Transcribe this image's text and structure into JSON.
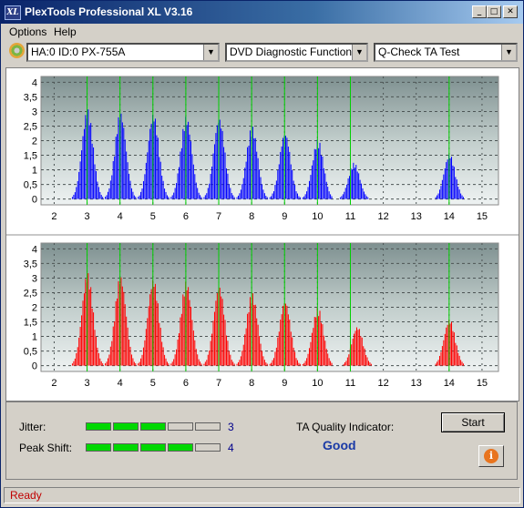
{
  "app": {
    "title": "PlexTools Professional XL V3.16",
    "icon_text": "XL",
    "buttons": {
      "minimize": "_",
      "maximize": "□",
      "close": "✕"
    }
  },
  "menu": [
    "Options",
    "Help"
  ],
  "toolbar": {
    "drive": "HA:0 ID:0  PX-755A",
    "function": "DVD Diagnostic Functions",
    "test": "Q-Check TA Test"
  },
  "chart_data": [
    {
      "type": "bar",
      "name": "top",
      "color": "#0000ff",
      "xlim": [
        1.6,
        15.5
      ],
      "ylim": [
        -0.2,
        4.2
      ],
      "x_ticks": [
        "2",
        "3",
        "4",
        "5",
        "6",
        "7",
        "8",
        "9",
        "10",
        "11",
        "12",
        "13",
        "14",
        "15"
      ],
      "y_ticks": [
        "0",
        "0,5",
        "1",
        "1,5",
        "2",
        "2,5",
        "3",
        "3,5",
        "4"
      ],
      "markers": [
        3,
        4,
        5,
        6,
        7,
        8,
        9,
        10,
        11,
        14
      ],
      "peaks": [
        {
          "x": 3.0,
          "h": 3.1
        },
        {
          "x": 4.0,
          "h": 3.0
        },
        {
          "x": 5.0,
          "h": 2.95
        },
        {
          "x": 6.0,
          "h": 2.85
        },
        {
          "x": 7.0,
          "h": 2.8
        },
        {
          "x": 8.0,
          "h": 2.5
        },
        {
          "x": 9.0,
          "h": 2.3
        },
        {
          "x": 10.0,
          "h": 2.05
        },
        {
          "x": 11.1,
          "h": 1.25
        },
        {
          "x": 14.0,
          "h": 1.55
        }
      ]
    },
    {
      "type": "bar",
      "name": "bottom",
      "color": "#ff0000",
      "xlim": [
        1.6,
        15.5
      ],
      "ylim": [
        -0.2,
        4.2
      ],
      "x_ticks": [
        "2",
        "3",
        "4",
        "5",
        "6",
        "7",
        "8",
        "9",
        "10",
        "11",
        "12",
        "13",
        "14",
        "15"
      ],
      "y_ticks": [
        "0",
        "0,5",
        "1",
        "1,5",
        "2",
        "2,5",
        "3",
        "3,5",
        "4"
      ],
      "markers": [
        3,
        4,
        5,
        6,
        7,
        8,
        9,
        10,
        11,
        14
      ],
      "peaks": [
        {
          "x": 3.0,
          "h": 3.2
        },
        {
          "x": 4.0,
          "h": 3.1
        },
        {
          "x": 5.0,
          "h": 3.0
        },
        {
          "x": 6.0,
          "h": 2.9
        },
        {
          "x": 7.0,
          "h": 2.75
        },
        {
          "x": 8.0,
          "h": 2.5
        },
        {
          "x": 9.0,
          "h": 2.25
        },
        {
          "x": 10.0,
          "h": 2.0
        },
        {
          "x": 11.2,
          "h": 1.35
        },
        {
          "x": 14.0,
          "h": 1.6
        }
      ]
    }
  ],
  "results": {
    "jitter_label": "Jitter:",
    "jitter_value": "3",
    "jitter_level": 3,
    "peak_label": "Peak Shift:",
    "peak_value": "4",
    "peak_level": 4,
    "quality_label": "TA Quality Indicator:",
    "quality_value": "Good",
    "start_label": "Start",
    "info_icon": "i"
  },
  "status": "Ready"
}
